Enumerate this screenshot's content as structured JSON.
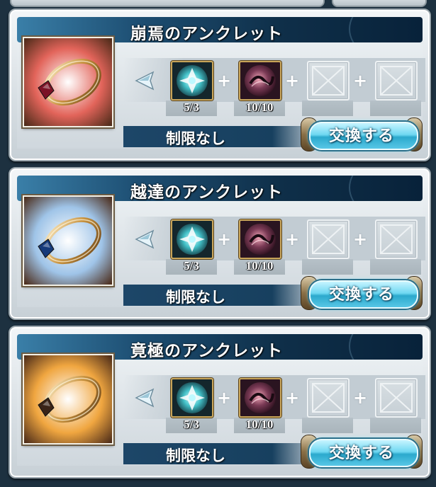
{
  "cards": [
    {
      "title": "崩焉のアンクレット",
      "ring_glow": "#e2645a",
      "gem_color": "#7b1326",
      "requirements": [
        {
          "count": "5/3",
          "icon": "crystal-icon"
        },
        {
          "count": "10/10",
          "icon": "dark-orb-icon"
        }
      ],
      "limit": "制限なし",
      "button": "交換する"
    },
    {
      "title": "越達のアンクレット",
      "ring_glow": "#9fc4e8",
      "gem_color": "#163a7a",
      "requirements": [
        {
          "count": "5/3",
          "icon": "crystal-icon"
        },
        {
          "count": "10/10",
          "icon": "dark-orb-icon"
        }
      ],
      "limit": "制限なし",
      "button": "交換する"
    },
    {
      "title": "竟極のアンクレット",
      "ring_glow": "#f0a640",
      "gem_color": "#3a2418",
      "requirements": [
        {
          "count": "5/3",
          "icon": "crystal-icon"
        },
        {
          "count": "10/10",
          "icon": "dark-orb-icon"
        }
      ],
      "limit": "制限なし",
      "button": "交換する"
    }
  ]
}
